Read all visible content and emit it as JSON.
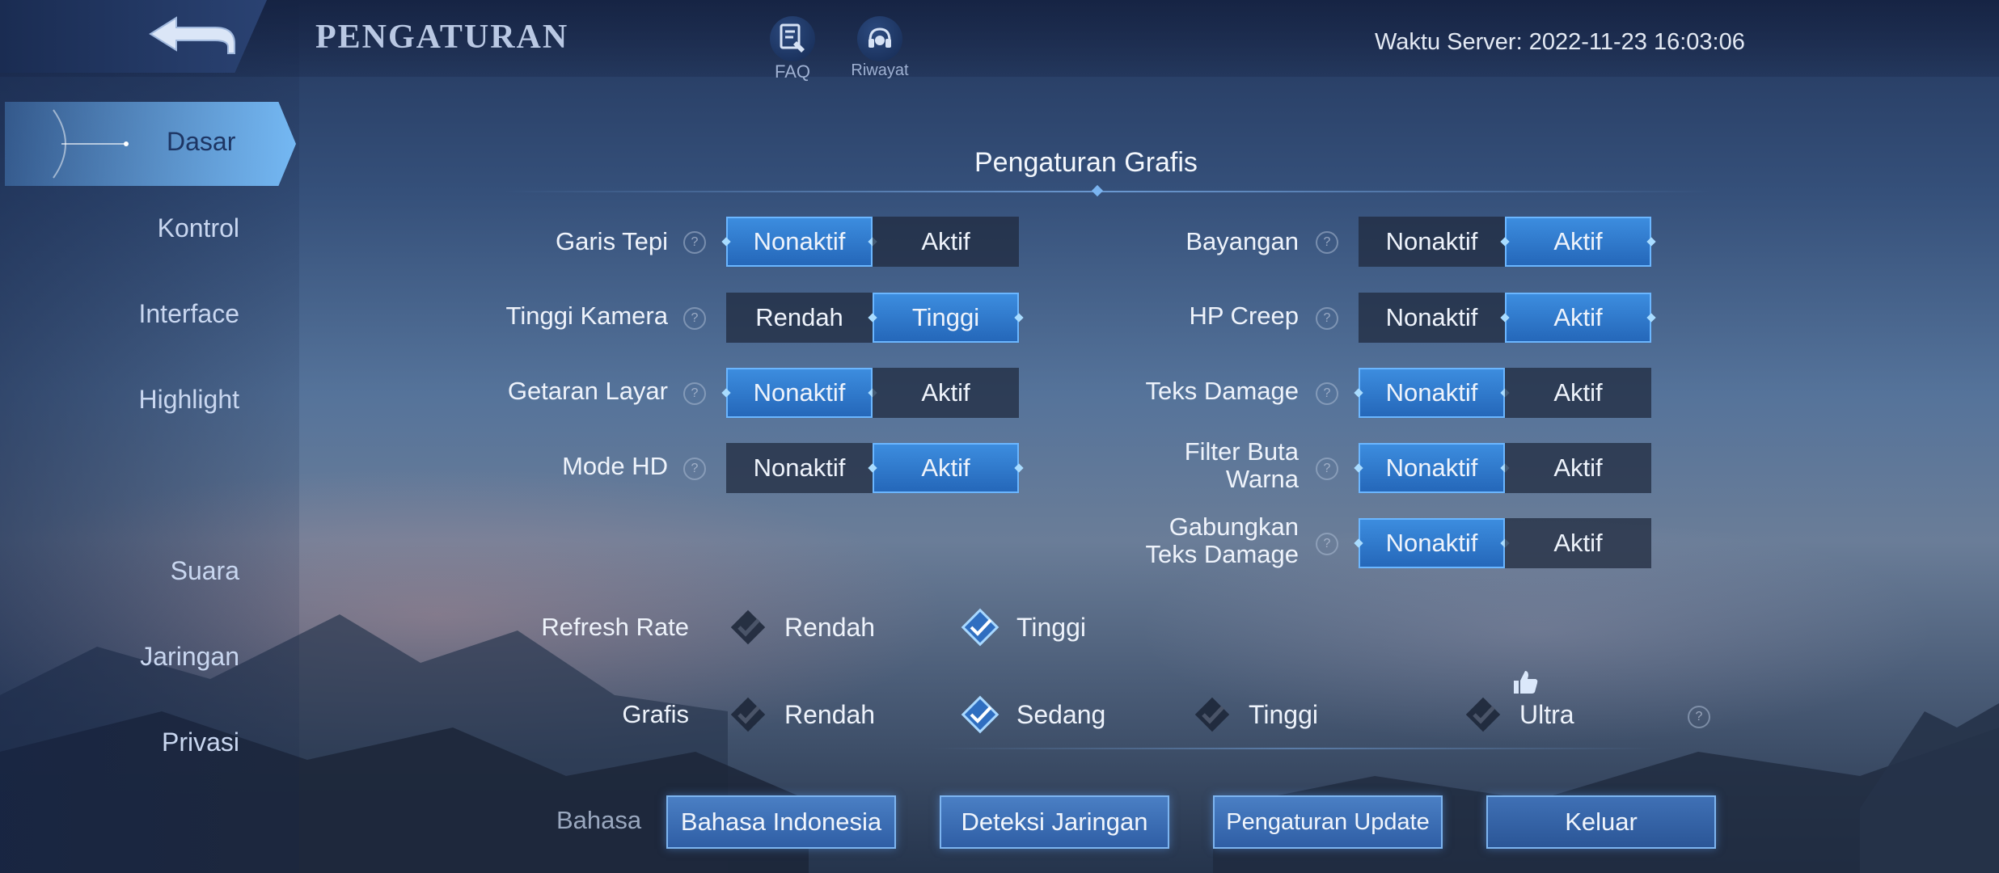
{
  "header": {
    "title": "PENGATURAN",
    "faq_label": "FAQ",
    "riwayat_label": "Riwayat",
    "server_time": "Waktu Server: 2022-11-23 16:03:06"
  },
  "sidebar": {
    "items": [
      {
        "label": "Dasar",
        "active": true
      },
      {
        "label": "Kontrol"
      },
      {
        "label": "Interface"
      },
      {
        "label": "Highlight"
      },
      {
        "label": "Suara"
      },
      {
        "label": "Jaringan"
      },
      {
        "label": "Privasi"
      }
    ]
  },
  "section": {
    "title": "Pengaturan Grafis"
  },
  "left_settings": [
    {
      "label": "Garis Tepi",
      "off": "Nonaktif",
      "on": "Aktif",
      "selected": "off"
    },
    {
      "label": "Tinggi Kamera",
      "off": "Rendah",
      "on": "Tinggi",
      "selected": "on"
    },
    {
      "label": "Getaran Layar",
      "off": "Nonaktif",
      "on": "Aktif",
      "selected": "off"
    },
    {
      "label": "Mode HD",
      "off": "Nonaktif",
      "on": "Aktif",
      "selected": "on"
    }
  ],
  "right_settings": [
    {
      "label": "Bayangan",
      "off": "Nonaktif",
      "on": "Aktif",
      "selected": "on"
    },
    {
      "label": "HP Creep",
      "off": "Nonaktif",
      "on": "Aktif",
      "selected": "on"
    },
    {
      "label": "Teks Damage",
      "off": "Nonaktif",
      "on": "Aktif",
      "selected": "off"
    },
    {
      "label_line1": "Filter Buta",
      "label_line2": "Warna",
      "off": "Nonaktif",
      "on": "Aktif",
      "selected": "off"
    },
    {
      "label_line1": "Gabungkan",
      "label_line2": "Teks Damage",
      "off": "Nonaktif",
      "on": "Aktif",
      "selected": "off"
    }
  ],
  "refresh_rate": {
    "label": "Refresh Rate",
    "options": [
      {
        "label": "Rendah",
        "selected": false
      },
      {
        "label": "Tinggi",
        "selected": true
      }
    ]
  },
  "grafis": {
    "label": "Grafis",
    "options": [
      {
        "label": "Rendah",
        "selected": false
      },
      {
        "label": "Sedang",
        "selected": true
      },
      {
        "label": "Tinggi",
        "selected": false
      },
      {
        "label": "Ultra",
        "selected": false,
        "badge": "thumbs-up-icon"
      }
    ]
  },
  "footer": {
    "bahasa_label": "Bahasa",
    "language_button": "Bahasa Indonesia",
    "network_button": "Deteksi Jaringan",
    "update_button": "Pengaturan Update",
    "exit_button": "Keluar"
  },
  "colors": {
    "accent": "#3d8ee0",
    "accent_border": "#6bb6ff",
    "toggle_off_bg": "#1e283c"
  }
}
